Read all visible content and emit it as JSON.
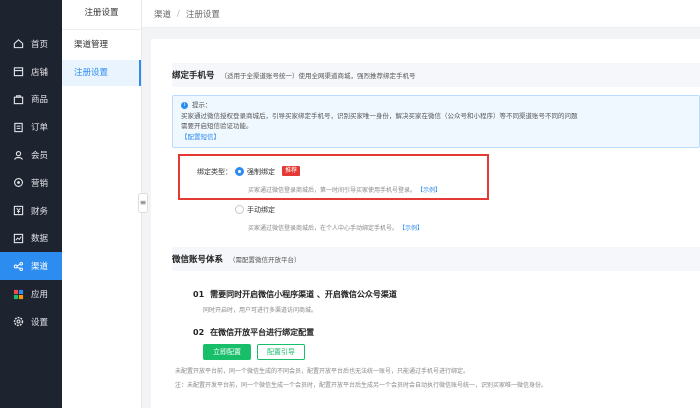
{
  "sidebar": {
    "items": [
      {
        "label": "首页",
        "icon": "home-icon"
      },
      {
        "label": "店铺",
        "icon": "store-icon"
      },
      {
        "label": "商品",
        "icon": "bag-icon"
      },
      {
        "label": "订单",
        "icon": "order-icon"
      },
      {
        "label": "会员",
        "icon": "user-icon"
      },
      {
        "label": "营销",
        "icon": "marketing-icon"
      },
      {
        "label": "财务",
        "icon": "finance-icon"
      },
      {
        "label": "数据",
        "icon": "chart-icon"
      },
      {
        "label": "渠道",
        "icon": "channel-icon"
      },
      {
        "label": "应用",
        "icon": "apps-icon"
      },
      {
        "label": "设置",
        "icon": "gear-icon"
      }
    ],
    "active_color": "#2d8cf0"
  },
  "subsidebar": {
    "title": "注册设置",
    "items": [
      {
        "label": "渠道管理"
      },
      {
        "label": "注册设置"
      }
    ]
  },
  "breadcrumb": {
    "items": [
      "渠道",
      "注册设置"
    ],
    "separator": "/"
  },
  "bind_phone": {
    "title": "绑定手机号",
    "hint": "（适用于全渠道账号统一）使用全网渠道商城，强烈推荐绑定手机号",
    "notice": {
      "title": "提示：",
      "line1": "买家通过微信授权登录商城后，引导买家绑定手机号，识别买家唯一身份，解决买家在微信（公众号和小程序）等不同渠道账号不同的问题",
      "line2": "需要开启短信验证功能。",
      "link": "【配置短信】"
    },
    "bind_type_label": "绑定类型：",
    "options": [
      {
        "label": "强制绑定",
        "tag": "推荐",
        "desc": "买家通过微信登录商城后，第一时间引导买家使用手机号登录。",
        "link": "【示例】",
        "selected": true
      },
      {
        "label": "手动绑定",
        "desc": "买家通过微信登录商城后，在个人中心手动绑定手机号。",
        "link": "【示例】",
        "selected": false
      }
    ]
  },
  "wechat_account": {
    "title": "微信账号体系",
    "hint": "（需配置微信开放平台）",
    "step1": {
      "num": "01",
      "title": "需要同时开启微信小程序渠道 、开启微信公众号渠道",
      "note": "同时开启时，用户可进行多渠道访问商城。"
    },
    "step2": {
      "num": "02",
      "title": "在微信开放平台进行绑定配置"
    },
    "btn_config_now": "立即配置",
    "btn_config_guide": "配置引导",
    "note1": "未配置开放平台前，同一个微信生成的不同会员，配置开放平台后也无法统一账号，只能通过手机号进行绑定。",
    "note2": "注：未配置开发平台前，同一个微信生成一个会员时，配置开放平台后生成另一个会员时会自动执行微信账号统一，识别买家唯一微信身份。"
  },
  "colors": {
    "primary": "#2d8cf0",
    "danger": "#e53935",
    "success": "#19be6b",
    "sidebar_bg": "#1e2330"
  }
}
